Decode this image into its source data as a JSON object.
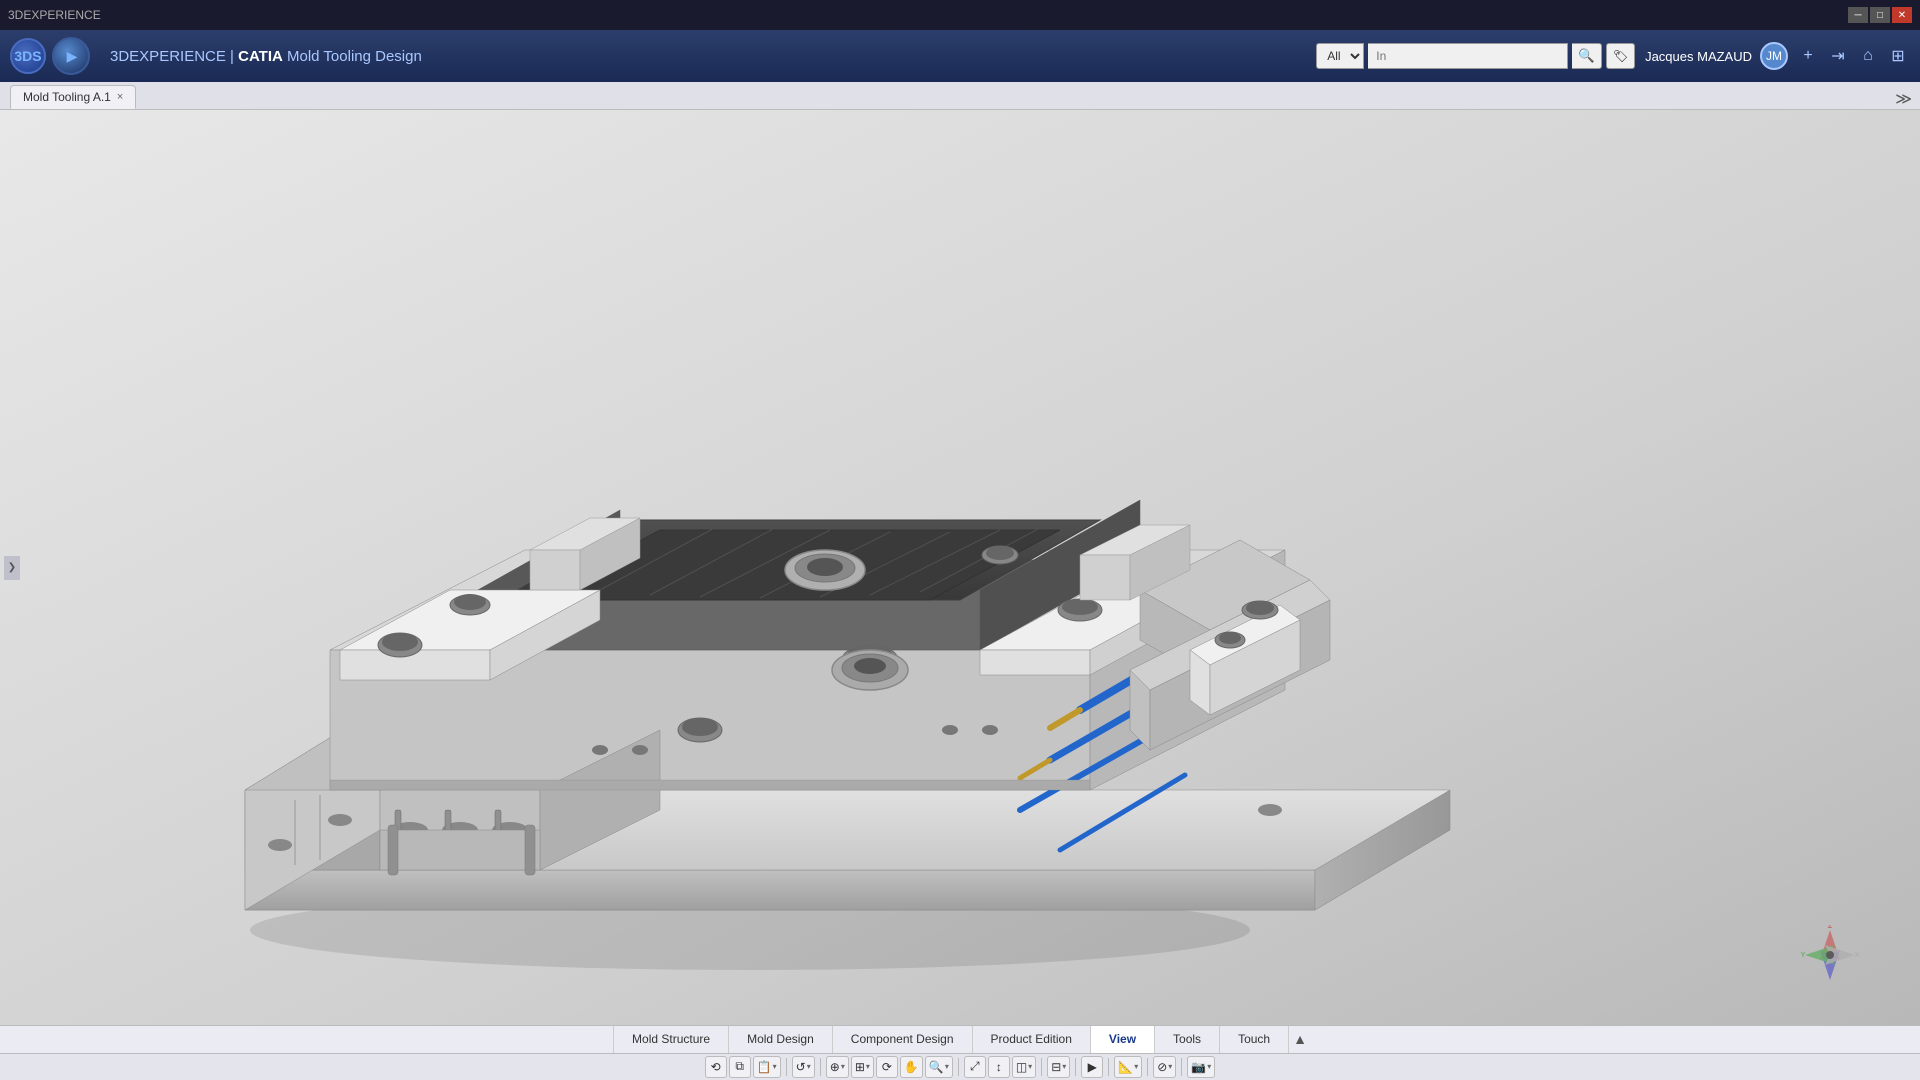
{
  "window": {
    "title": "3DEXPERIENCE"
  },
  "titlebar": {
    "minimize_label": "─",
    "maximize_label": "□",
    "close_label": "✕"
  },
  "header": {
    "logo_text": "3DS",
    "brand": "3DEXPERIENCE",
    "separator": " | ",
    "product": "CATIA",
    "module": "Mold Tooling Design",
    "search_dropdown": "All",
    "search_placeholder": "In",
    "user_name": "Jacques MAZAUD",
    "user_initials": "JM"
  },
  "tab": {
    "label": "Mold Tooling A.1",
    "close_icon": "×"
  },
  "toolbar_icons": {
    "plus": "+",
    "share": "⇥",
    "home": "⌂",
    "grid": "⊞"
  },
  "menu_tabs": [
    {
      "id": "mold-structure",
      "label": "Mold Structure",
      "active": false
    },
    {
      "id": "mold-design",
      "label": "Mold Design",
      "active": false
    },
    {
      "id": "component-design",
      "label": "Component Design",
      "active": false
    },
    {
      "id": "product-edition",
      "label": "Product Edition",
      "active": false
    },
    {
      "id": "view",
      "label": "View",
      "active": true
    },
    {
      "id": "tools",
      "label": "Tools",
      "active": false
    },
    {
      "id": "touch",
      "label": "Touch",
      "active": false
    }
  ],
  "tool_buttons": [
    {
      "id": "rotate",
      "icon": "⟲",
      "tooltip": "Rotate"
    },
    {
      "id": "copy",
      "icon": "⧉",
      "tooltip": "Copy"
    },
    {
      "id": "paste-dropdown",
      "icon": "📋▾",
      "tooltip": "Paste options"
    },
    {
      "id": "undo",
      "icon": "↺",
      "tooltip": "Undo"
    },
    {
      "id": "undo-dropdown",
      "icon": "▾",
      "tooltip": "Undo options"
    },
    {
      "id": "select",
      "icon": "⊕",
      "tooltip": "Select"
    },
    {
      "id": "select-dropdown",
      "icon": "▾",
      "tooltip": "Select options"
    },
    {
      "id": "snap",
      "icon": "⊞",
      "tooltip": "Snap"
    },
    {
      "id": "snap-dropdown",
      "icon": "▾",
      "tooltip": "Snap options"
    },
    {
      "id": "orbit",
      "icon": "⟳",
      "tooltip": "Orbit"
    },
    {
      "id": "pan",
      "icon": "✋",
      "tooltip": "Pan"
    },
    {
      "id": "zoom",
      "icon": "🔍",
      "tooltip": "Zoom"
    },
    {
      "id": "zoom-dropdown",
      "icon": "▾",
      "tooltip": "Zoom options"
    },
    {
      "id": "fit-all",
      "icon": "⤢",
      "tooltip": "Fit All"
    },
    {
      "id": "normal",
      "icon": "↕",
      "tooltip": "Normal View"
    },
    {
      "id": "render",
      "icon": "◫",
      "tooltip": "Rendering"
    },
    {
      "id": "render-dropdown",
      "icon": "▾",
      "tooltip": "Render options"
    },
    {
      "id": "display",
      "icon": "⊟",
      "tooltip": "Display"
    },
    {
      "id": "display-dropdown",
      "icon": "▾",
      "tooltip": "Display options"
    },
    {
      "id": "play",
      "icon": "▶",
      "tooltip": "Play"
    },
    {
      "id": "measure",
      "icon": "📐",
      "tooltip": "Measure"
    },
    {
      "id": "measure-dropdown",
      "icon": "▾",
      "tooltip": "Measure options"
    },
    {
      "id": "section",
      "icon": "⊘",
      "tooltip": "Section"
    },
    {
      "id": "section-dropdown",
      "icon": "▾",
      "tooltip": "Section options"
    },
    {
      "id": "camera",
      "icon": "📷",
      "tooltip": "Camera"
    },
    {
      "id": "camera-dropdown",
      "icon": "▾",
      "tooltip": "Camera options"
    }
  ],
  "compass": {
    "label": "3D Compass"
  },
  "left_arrow": "❯",
  "viewport_bg": "#d0d0d0"
}
